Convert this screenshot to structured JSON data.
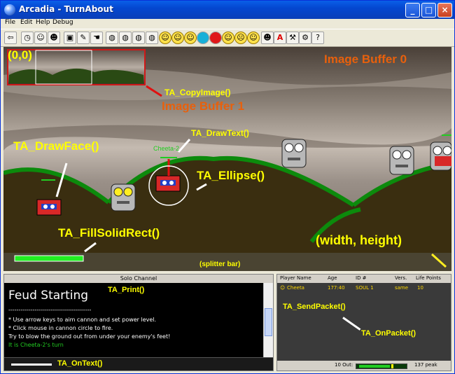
{
  "window": {
    "title": "Arcadia - TurnAbout"
  },
  "menu": {
    "items": [
      "File",
      "Edit",
      "Help",
      "Debug"
    ]
  },
  "game": {
    "origin_label": "(0,0)",
    "buffer0_label": "Image Buffer 0",
    "buffer1_label": "Image Buffer 1",
    "copyimage_label": "TA_CopyImage()",
    "drawtext_label": "TA_DrawText()",
    "drawface_label": "TA_DrawFace()",
    "ellipse_label": "TA_Ellipse()",
    "fillsolidrect_label": "TA_FillSolidRect()",
    "widthheight_label": "(width, height)",
    "splitter_label": "(splitter bar)",
    "player_tag": "Cheeta-2"
  },
  "solo": {
    "header": "Solo Channel",
    "feud": "Feud Starting",
    "print_label": "TA_Print()",
    "divider": "-----------------------------------------",
    "lines": [
      "* Use arrow keys to aim cannon and set power level.",
      "* Click mouse in cannon circle to fire.",
      "Try to blow the ground out from under your enemy's feet!"
    ],
    "turn_prefix": "It is ",
    "turn_name": "Cheeta-2",
    "turn_suffix": "'s turn",
    "ontext_label": "TA_OnText()"
  },
  "players": {
    "columns": [
      "Player Name",
      "Age",
      "ID #",
      "Vers.",
      "Life Points"
    ],
    "rows": [
      {
        "name": "Cheeta",
        "age": "177:40",
        "id": "SOUL 1",
        "vers": "same",
        "life": "10"
      }
    ],
    "sendpacket_label": "TA_SendPacket()",
    "onpacket_label": "TA_OnPacket()",
    "status_left": "10 Out:",
    "status_right": "137 peak"
  },
  "colors": {
    "label_yellow": "#ffff00",
    "label_orange": "#e8600c",
    "hill_green": "#0c8a0c",
    "dirt": "#3a2e10",
    "player_tag_green": "#22cc22"
  }
}
